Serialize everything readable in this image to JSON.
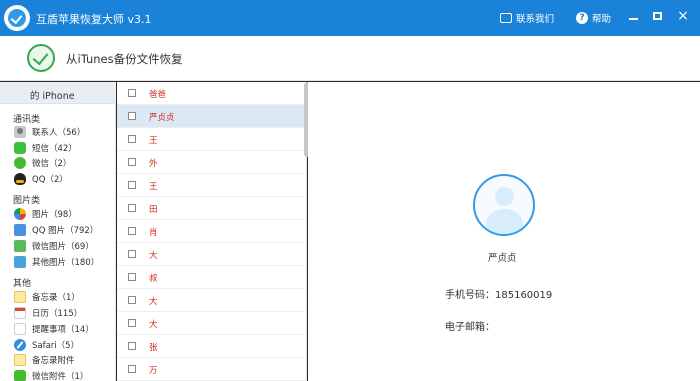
{
  "window": {
    "title": "互盾苹果恢复大师 v3.1",
    "contact_label": "联系我们",
    "help_label": "帮助",
    "close_glyph": "×"
  },
  "header": {
    "title": "从iTunes备份文件恢复"
  },
  "sidebar": {
    "device": "的 iPhone",
    "groups": [
      {
        "label": "通讯类",
        "items": [
          {
            "label": "联系人（56）",
            "icon": "contacts-icon"
          },
          {
            "label": "短信（42）",
            "icon": "sms-icon"
          },
          {
            "label": "微信（2）",
            "icon": "wechat-icon"
          },
          {
            "label": "QQ（2）",
            "icon": "qq-icon"
          }
        ]
      },
      {
        "label": "图片类",
        "items": [
          {
            "label": "图片（98）",
            "icon": "photos-icon"
          },
          {
            "label": "QQ 图片（792）",
            "icon": "qq-photos-icon"
          },
          {
            "label": "微信图片（69）",
            "icon": "wechat-photos-icon"
          },
          {
            "label": "其他图片（180）",
            "icon": "other-photos-icon"
          }
        ]
      },
      {
        "label": "其他",
        "items": [
          {
            "label": "备忘录（1）",
            "icon": "notes-icon"
          },
          {
            "label": "日历（115）",
            "icon": "calendar-icon"
          },
          {
            "label": "提醒事项（14）",
            "icon": "reminders-icon"
          },
          {
            "label": "Safari（5）",
            "icon": "safari-icon"
          },
          {
            "label": "备忘录附件",
            "icon": "notes-attachment-icon"
          },
          {
            "label": "微信附件（1）",
            "icon": "wechat-attachment-icon"
          }
        ]
      }
    ]
  },
  "contact_list": {
    "selected_index": 1,
    "rows": [
      {
        "name": "爸爸"
      },
      {
        "name": "严贞贞"
      },
      {
        "name": "王"
      },
      {
        "name": "外"
      },
      {
        "name": "王"
      },
      {
        "name": "田"
      },
      {
        "name": "肖"
      },
      {
        "name": "大"
      },
      {
        "name": "叔"
      },
      {
        "name": "大"
      },
      {
        "name": "大"
      },
      {
        "name": "张"
      },
      {
        "name": "万"
      }
    ]
  },
  "detail": {
    "name": "严贞贞",
    "phone_label": "手机号码：",
    "phone_value": "185160019",
    "email_label": "电子邮箱：",
    "email_value": ""
  },
  "colors": {
    "titlebar": "#1a82d8",
    "selected_row": "#dbe9f6",
    "contact_name": "#d4281b"
  }
}
